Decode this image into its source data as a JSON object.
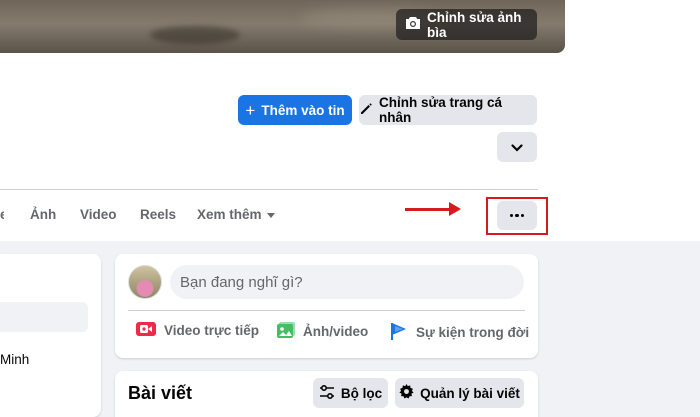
{
  "cover": {
    "edit_cover_label": "Chỉnh sửa ảnh bìa",
    "camera_icon": "camera-icon"
  },
  "profile_actions": {
    "add_story_label": "Thêm vào tin",
    "add_story_icon": "plus-icon",
    "edit_profile_label": "Chỉnh sửa trang cá nhân",
    "edit_profile_icon": "pencil-icon",
    "expand_icon": "chevron-down-icon"
  },
  "tabs": [
    {
      "label": "Ảnh"
    },
    {
      "label": "Video"
    },
    {
      "label": "Reels"
    },
    {
      "label": "Xem thêm"
    }
  ],
  "more_button": {
    "icon": "more-horizontal-icon",
    "annotation_color": "#d71920"
  },
  "sidebar": {
    "partial_text": "Minh"
  },
  "composer": {
    "placeholder": "Bạn đang nghĩ gì?",
    "actions": [
      {
        "label": "Video trực tiếp",
        "icon": "live-video-icon",
        "color": "#f02849"
      },
      {
        "label": "Ảnh/video",
        "icon": "photo-icon",
        "color": "#45bd62"
      },
      {
        "label": "Sự kiện trong đời",
        "icon": "flag-icon",
        "color": "#1b74e4"
      }
    ]
  },
  "posts": {
    "title": "Bài viết",
    "filter_label": "Bộ lọc",
    "filter_icon": "filter-sliders-icon",
    "manage_label": "Quản lý bài viết",
    "manage_icon": "gear-icon"
  },
  "colors": {
    "primary": "#1b74e4",
    "secondary_button": "#e4e6eb",
    "background": "#f0f2f5",
    "annotation": "#d71920"
  }
}
